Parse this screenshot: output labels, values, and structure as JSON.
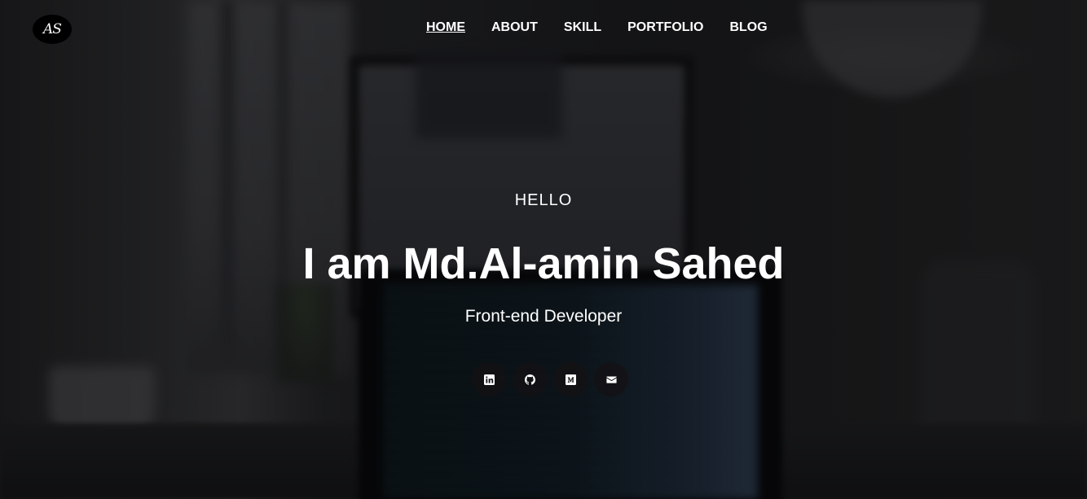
{
  "logo": {
    "text": "AS"
  },
  "nav": {
    "items": [
      {
        "label": "HOME",
        "active": true
      },
      {
        "label": "ABOUT",
        "active": false
      },
      {
        "label": "SKILL",
        "active": false
      },
      {
        "label": "PORTFOLIO",
        "active": false
      },
      {
        "label": "BLOG",
        "active": false
      }
    ]
  },
  "hero": {
    "greeting": "HELLO",
    "name": "I am Md.Al-amin Sahed",
    "role": "Front-end Developer"
  },
  "socials": [
    {
      "icon": "linkedin-icon"
    },
    {
      "icon": "github-icon"
    },
    {
      "icon": "medium-icon"
    },
    {
      "icon": "envelope-icon"
    }
  ],
  "colors": {
    "text": "#ffffff",
    "overlay": "#000000",
    "logo_bg": "#000000"
  }
}
